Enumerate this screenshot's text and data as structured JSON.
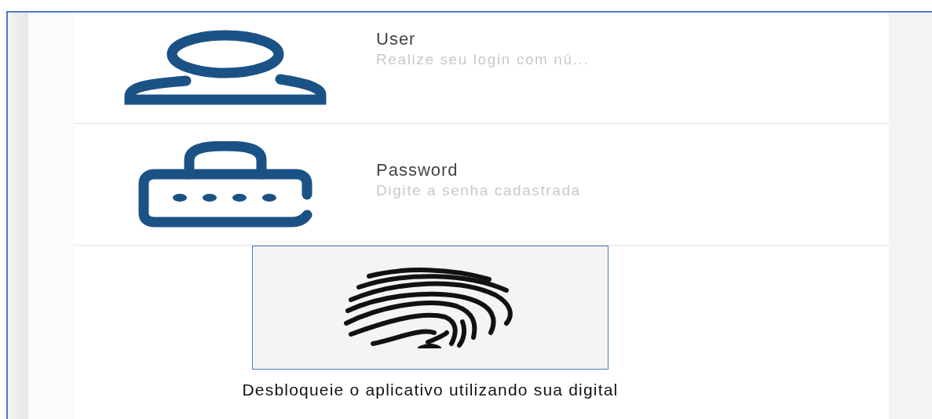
{
  "fields": [
    {
      "kind": "user",
      "label": "User",
      "placeholder": "Realize seu login com nú..."
    },
    {
      "kind": "password",
      "label": "Password",
      "placeholder": "Digite a senha cadastrada"
    }
  ],
  "fingerprint": {
    "caption": "Desbloqueie o aplicativo utilizando sua digital"
  }
}
